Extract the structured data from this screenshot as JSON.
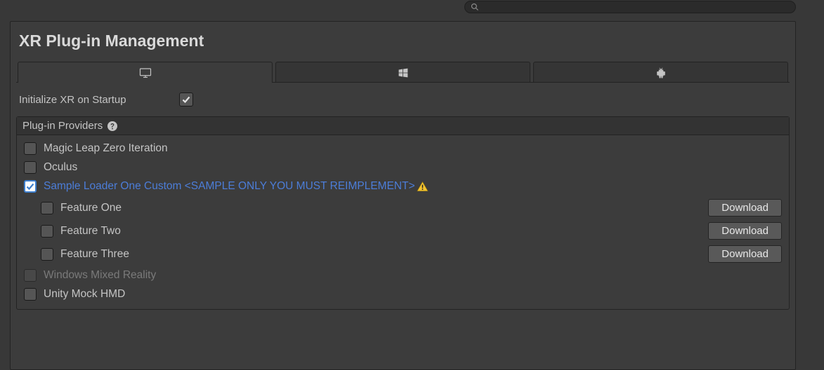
{
  "search": {
    "placeholder": ""
  },
  "page": {
    "title": "XR Plug-in Management",
    "init_label": "Initialize XR on Startup",
    "init_checked": true
  },
  "providers": {
    "header": "Plug-in Providers",
    "items": [
      {
        "label": "Magic Leap Zero Iteration",
        "checked": false,
        "highlight": false,
        "disabled": false
      },
      {
        "label": "Oculus",
        "checked": false,
        "highlight": false,
        "disabled": false
      },
      {
        "label": "Sample Loader One Custom <SAMPLE ONLY YOU MUST REIMPLEMENT>",
        "checked": true,
        "highlight": true,
        "disabled": false,
        "warning": true,
        "features": [
          {
            "label": "Feature One",
            "checked": false,
            "button": "Download"
          },
          {
            "label": "Feature Two",
            "checked": false,
            "button": "Download"
          },
          {
            "label": "Feature Three",
            "checked": false,
            "button": "Download"
          }
        ]
      },
      {
        "label": "Windows Mixed Reality",
        "checked": false,
        "highlight": false,
        "disabled": true
      },
      {
        "label": "Unity Mock HMD",
        "checked": false,
        "highlight": false,
        "disabled": false
      }
    ]
  },
  "tabs": {
    "active": 0,
    "items": [
      {
        "icon": "monitor-icon"
      },
      {
        "icon": "windows-icon"
      },
      {
        "icon": "android-icon"
      }
    ]
  }
}
